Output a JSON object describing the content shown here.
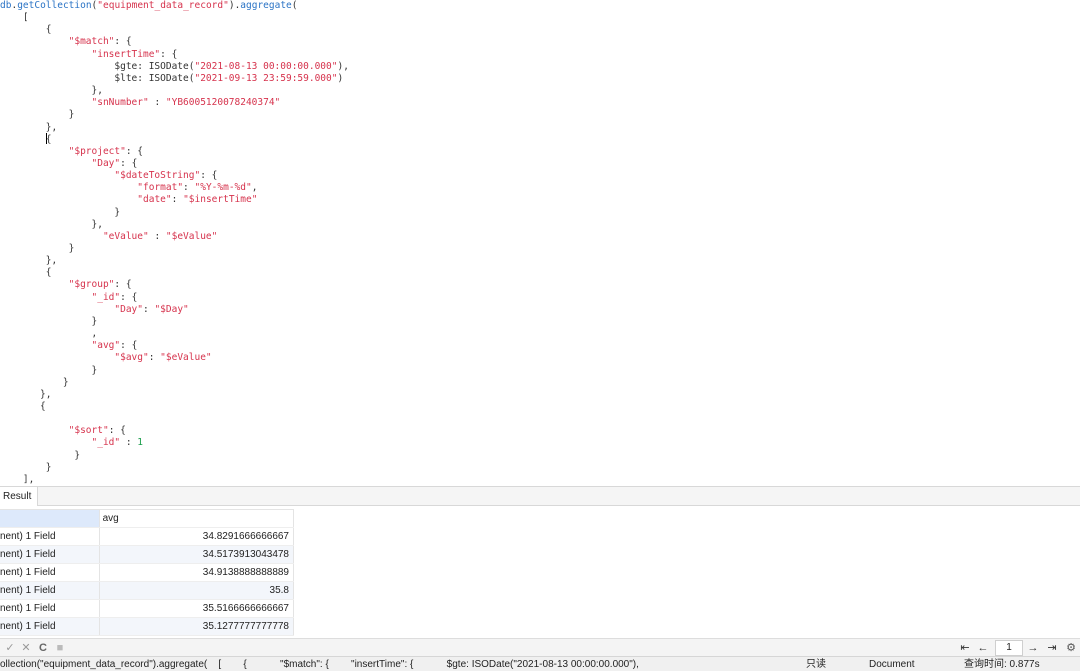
{
  "editor": {
    "lines": [
      [
        [
          "f",
          "db"
        ],
        [
          "p",
          "."
        ],
        [
          "f",
          "getCollection"
        ],
        [
          "p",
          "("
        ],
        [
          "s",
          "\"equipment_data_record\""
        ],
        [
          "p",
          ")."
        ],
        [
          "f",
          "aggregate"
        ],
        [
          "p",
          "("
        ]
      ],
      [
        [
          "p",
          "    ["
        ]
      ],
      [
        [
          "p",
          "        {"
        ]
      ],
      [
        [
          "p",
          "            "
        ],
        [
          "k",
          "\"$match\""
        ],
        [
          "p",
          ": {"
        ]
      ],
      [
        [
          "p",
          "                "
        ],
        [
          "k",
          "\"insertTime\""
        ],
        [
          "p",
          ": {"
        ]
      ],
      [
        [
          "p",
          "                    $gte: ISODate("
        ],
        [
          "s",
          "\"2021-08-13 00:00:00.000\""
        ],
        [
          "p",
          "),"
        ]
      ],
      [
        [
          "p",
          "                    $lte: ISODate("
        ],
        [
          "s",
          "\"2021-09-13 23:59:59.000\""
        ],
        [
          "p",
          ")"
        ]
      ],
      [
        [
          "p",
          "                },"
        ]
      ],
      [
        [
          "p",
          "                "
        ],
        [
          "k",
          "\"snNumber\""
        ],
        [
          "p",
          " : "
        ],
        [
          "s",
          "\"YB6005120078240374\""
        ]
      ],
      [
        [
          "p",
          "            }"
        ]
      ],
      [
        [
          "p",
          "        },"
        ]
      ],
      [
        [
          "p",
          "        {"
        ]
      ],
      [
        [
          "p",
          "            "
        ],
        [
          "k",
          "\"$project\""
        ],
        [
          "p",
          ": {"
        ]
      ],
      [
        [
          "p",
          "                "
        ],
        [
          "k",
          "\"Day\""
        ],
        [
          "p",
          ": {"
        ]
      ],
      [
        [
          "p",
          "                    "
        ],
        [
          "k",
          "\"$dateToString\""
        ],
        [
          "p",
          ": {"
        ]
      ],
      [
        [
          "p",
          "                        "
        ],
        [
          "k",
          "\"format\""
        ],
        [
          "p",
          ": "
        ],
        [
          "s",
          "\"%Y-%m-%d\""
        ],
        [
          "p",
          ","
        ]
      ],
      [
        [
          "p",
          "                        "
        ],
        [
          "k",
          "\"date\""
        ],
        [
          "p",
          ": "
        ],
        [
          "s",
          "\"$insertTime\""
        ]
      ],
      [
        [
          "p",
          "                    }"
        ]
      ],
      [
        [
          "p",
          "                },"
        ]
      ],
      [
        [
          "p",
          "                  "
        ],
        [
          "k",
          "\"eValue\""
        ],
        [
          "p",
          " : "
        ],
        [
          "s",
          "\"$eValue\""
        ]
      ],
      [
        [
          "p",
          "            }"
        ]
      ],
      [
        [
          "p",
          "        },"
        ]
      ],
      [
        [
          "p",
          "        {"
        ]
      ],
      [
        [
          "p",
          "            "
        ],
        [
          "k",
          "\"$group\""
        ],
        [
          "p",
          ": {"
        ]
      ],
      [
        [
          "p",
          "                "
        ],
        [
          "k",
          "\"_id\""
        ],
        [
          "p",
          ": {"
        ]
      ],
      [
        [
          "p",
          "                    "
        ],
        [
          "k",
          "\"Day\""
        ],
        [
          "p",
          ": "
        ],
        [
          "s",
          "\"$Day\""
        ]
      ],
      [
        [
          "p",
          "                }"
        ]
      ],
      [
        [
          "p",
          "                ,"
        ]
      ],
      [
        [
          "p",
          "                "
        ],
        [
          "k",
          "\"avg\""
        ],
        [
          "p",
          ": {"
        ]
      ],
      [
        [
          "p",
          "                    "
        ],
        [
          "k",
          "\"$avg\""
        ],
        [
          "p",
          ": "
        ],
        [
          "s",
          "\"$eValue\""
        ]
      ],
      [
        [
          "p",
          "                }"
        ]
      ],
      [
        [
          "p",
          "           }"
        ]
      ],
      [
        [
          "p",
          "       },"
        ]
      ],
      [
        [
          "p",
          "       {"
        ]
      ],
      [
        [
          "p",
          ""
        ]
      ],
      [
        [
          "p",
          "            "
        ],
        [
          "k",
          "\"$sort\""
        ],
        [
          "p",
          ": {"
        ]
      ],
      [
        [
          "p",
          "                "
        ],
        [
          "k",
          "\"_id\""
        ],
        [
          "p",
          " : "
        ],
        [
          "n",
          "1"
        ]
      ],
      [
        [
          "p",
          "             }"
        ]
      ],
      [
        [
          "p",
          "        }"
        ]
      ],
      [
        [
          "p",
          "    ],"
        ]
      ],
      [
        [
          "p",
          "    {"
        ]
      ]
    ]
  },
  "result": {
    "tab_label": "Result",
    "columns": [
      "",
      "avg"
    ],
    "rows": [
      {
        "doc": "nent) 1 Field",
        "avg": "34.8291666666667"
      },
      {
        "doc": "nent) 1 Field",
        "avg": "34.5173913043478"
      },
      {
        "doc": "nent) 1 Field",
        "avg": "34.9138888888889"
      },
      {
        "doc": "nent) 1 Field",
        "avg": "35.8"
      },
      {
        "doc": "nent) 1 Field",
        "avg": "35.5166666666667"
      },
      {
        "doc": "nent) 1 Field",
        "avg": "35.1277777777778"
      }
    ]
  },
  "toolbar": {
    "confirm_glyph": "✓",
    "discard_glyph": "✕",
    "refresh_glyph": "C",
    "stop_glyph": "■",
    "first_glyph": "⇤",
    "prev_glyph": "←",
    "page_value": "1",
    "next_glyph": "→",
    "last_glyph": "⇥",
    "settings_glyph": "⚙"
  },
  "status": {
    "query_preview": "ollection(\"equipment_data_record\").aggregate(    [        {            \"$match\": {        \"insertTime\": {            $gte: ISODate(\"2021-08-13 00:00:00.000\"),",
    "readonly": "只读",
    "view_mode": "Document",
    "query_time": "查询时间: 0.877s"
  },
  "colors": {
    "keyword": "#d6334d",
    "function": "#2a73c5",
    "number": "#1a9d4a",
    "header_selected": "#dde9fb"
  }
}
